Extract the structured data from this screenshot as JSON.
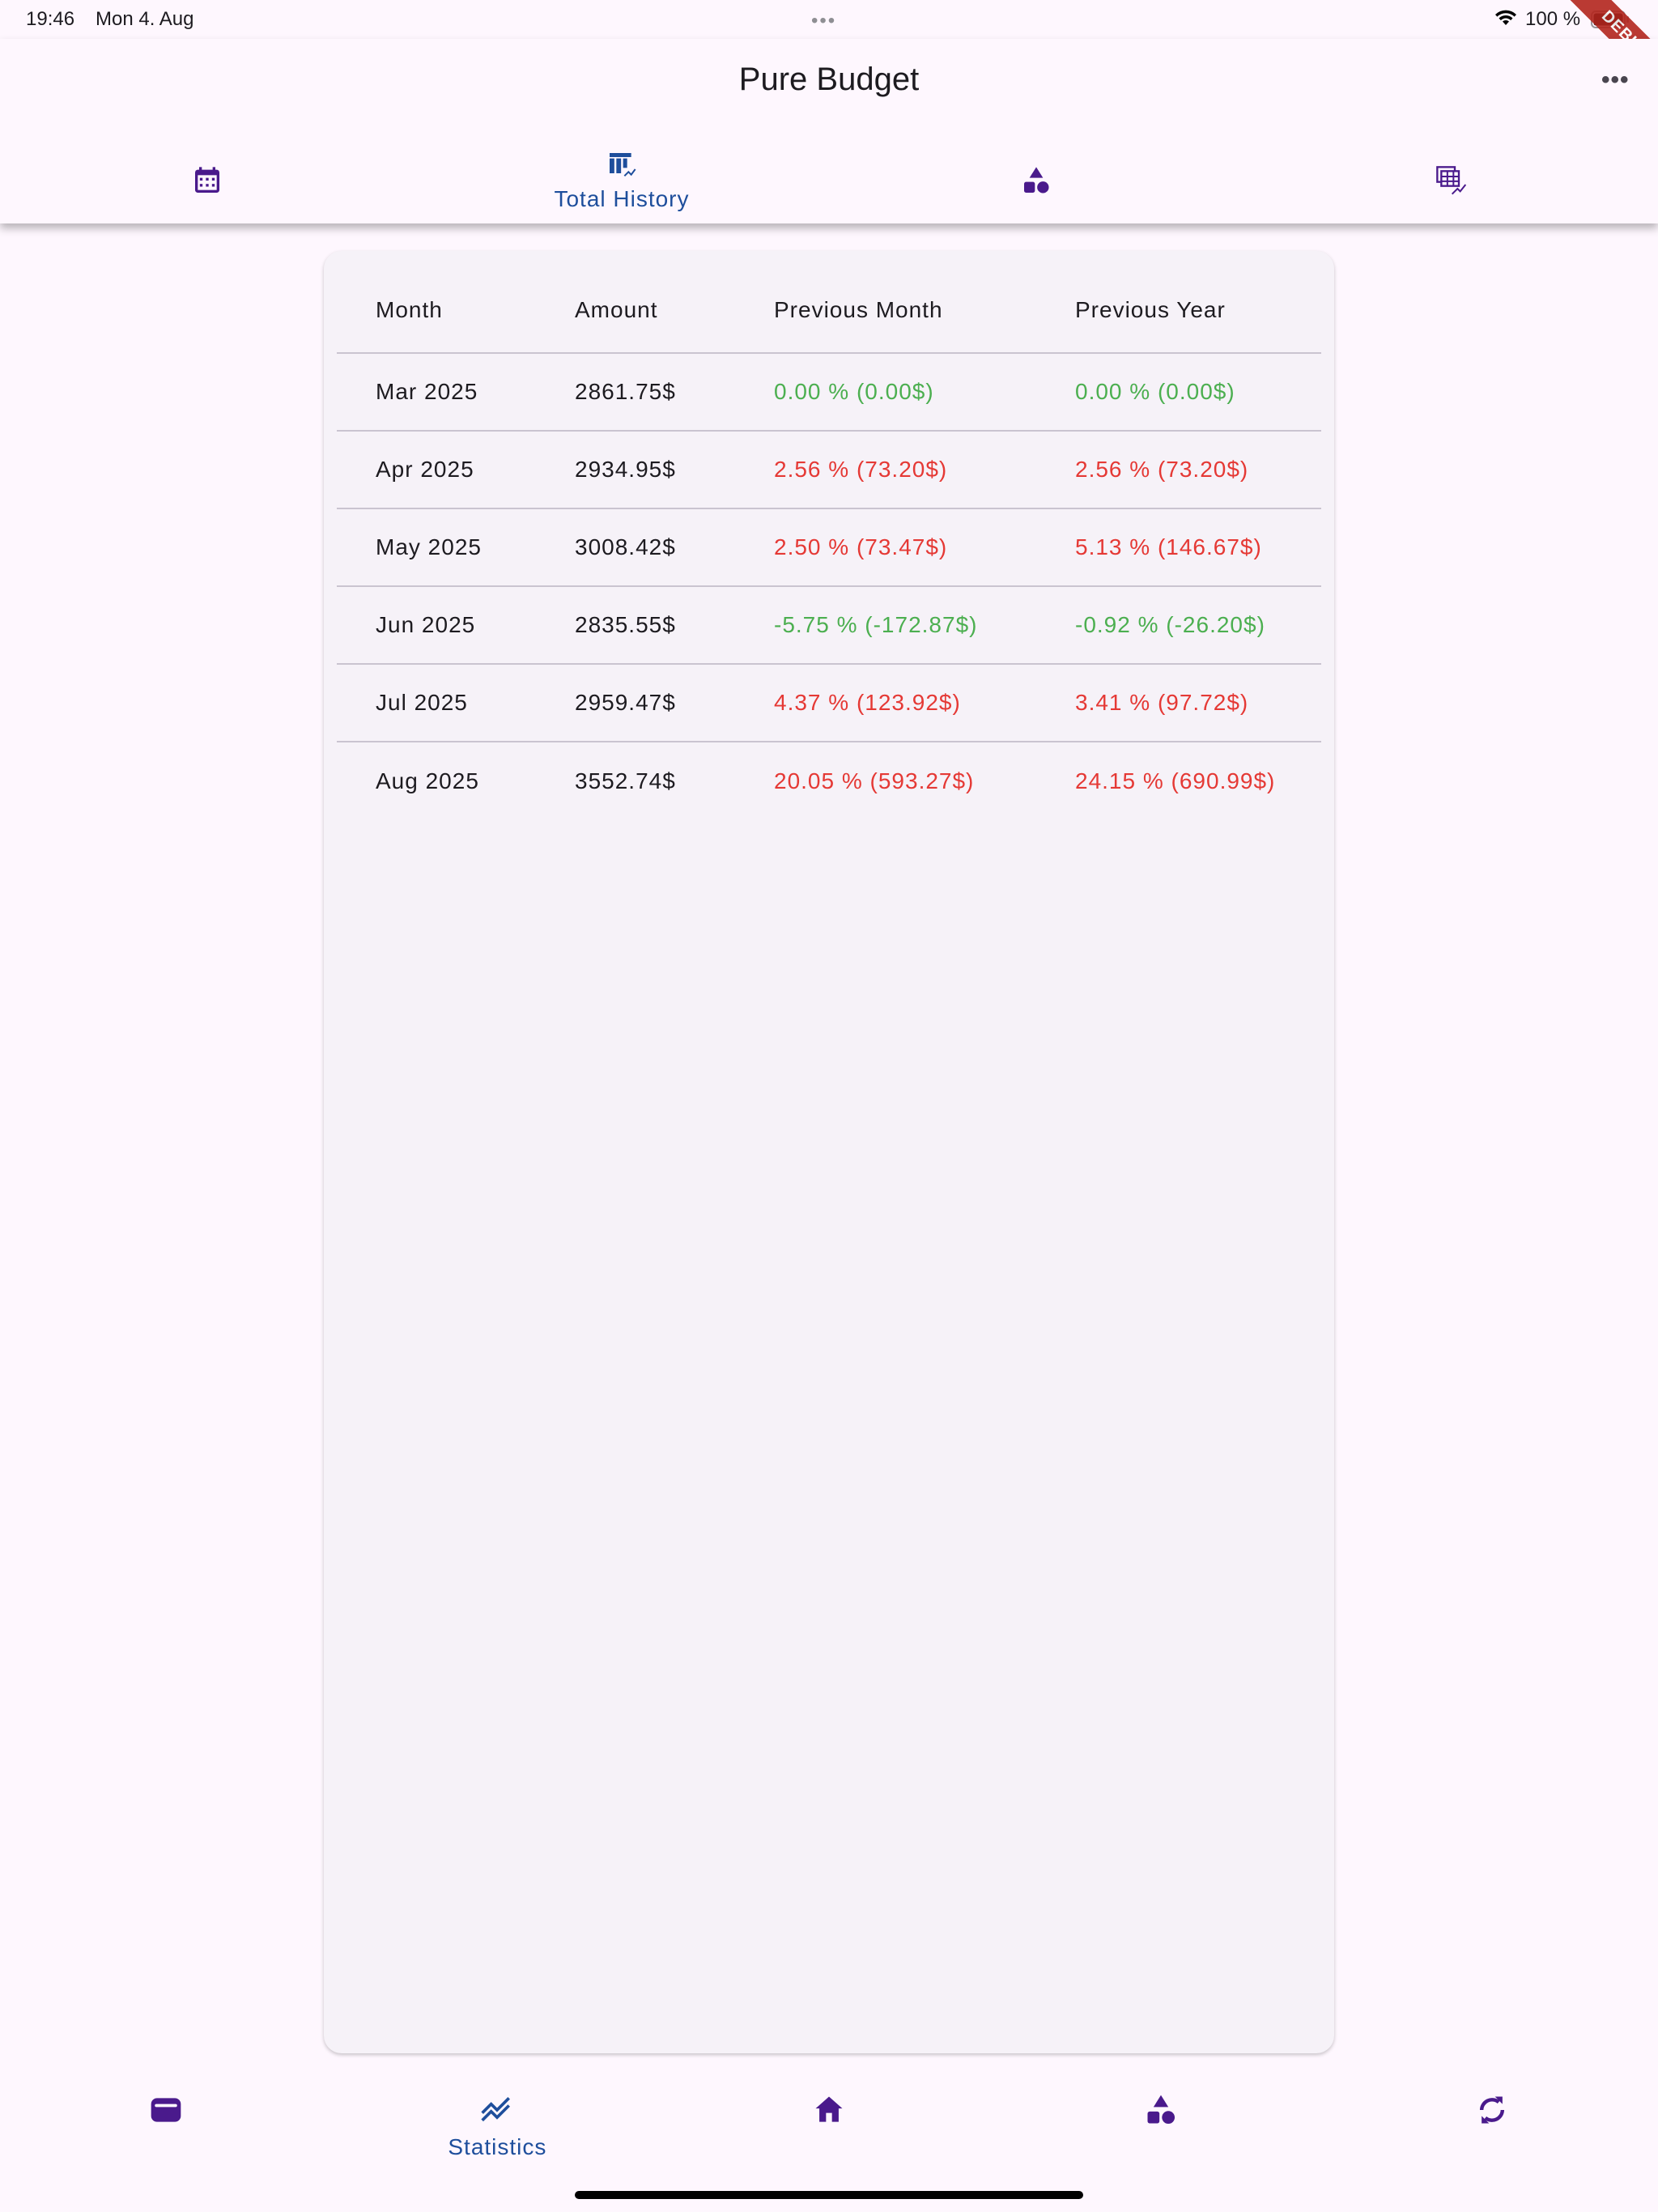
{
  "status_bar": {
    "time": "19:46",
    "date": "Mon 4. Aug",
    "battery": "100 %",
    "debug": "DEBUG"
  },
  "app_bar": {
    "title": "Pure Budget",
    "more_icon": "more-horizontal-icon",
    "tabs": [
      {
        "icon": "calendar-icon",
        "label": ""
      },
      {
        "icon": "table-history-icon",
        "label": "Total History",
        "active": true
      },
      {
        "icon": "category-shapes-icon",
        "label": ""
      },
      {
        "icon": "table-trend-icon",
        "label": ""
      }
    ]
  },
  "table": {
    "headers": [
      "Month",
      "Amount",
      "Previous Month",
      "Previous Year"
    ],
    "rows": [
      {
        "month": "Mar 2025",
        "amount": "2861.75$",
        "prev_month": "0.00 % (0.00$)",
        "prev_month_trend": "pos",
        "prev_year": "0.00 % (0.00$)",
        "prev_year_trend": "pos"
      },
      {
        "month": "Apr 2025",
        "amount": "2934.95$",
        "prev_month": "2.56 % (73.20$)",
        "prev_month_trend": "neg",
        "prev_year": "2.56 % (73.20$)",
        "prev_year_trend": "neg"
      },
      {
        "month": "May 2025",
        "amount": "3008.42$",
        "prev_month": "2.50 % (73.47$)",
        "prev_month_trend": "neg",
        "prev_year": "5.13 % (146.67$)",
        "prev_year_trend": "neg"
      },
      {
        "month": "Jun 2025",
        "amount": "2835.55$",
        "prev_month": "-5.75 % (-172.87$)",
        "prev_month_trend": "pos",
        "prev_year": "-0.92 % (-26.20$)",
        "prev_year_trend": "pos"
      },
      {
        "month": "Jul 2025",
        "amount": "2959.47$",
        "prev_month": "4.37 % (123.92$)",
        "prev_month_trend": "neg",
        "prev_year": "3.41 % (97.72$)",
        "prev_year_trend": "neg"
      },
      {
        "month": "Aug 2025",
        "amount": "3552.74$",
        "prev_month": "20.05 % (593.27$)",
        "prev_month_trend": "neg",
        "prev_year": "24.15 % (690.99$)",
        "prev_year_trend": "neg"
      }
    ]
  },
  "bottom_nav": [
    {
      "icon": "wallet-icon",
      "label": ""
    },
    {
      "icon": "statistics-icon",
      "label": "Statistics",
      "active": true
    },
    {
      "icon": "home-icon",
      "label": ""
    },
    {
      "icon": "category-shapes-icon",
      "label": ""
    },
    {
      "icon": "sync-icon",
      "label": ""
    }
  ],
  "colors": {
    "background": "#fef7fe",
    "card": "#f6f2f8",
    "accent": "#1e4e9c",
    "icon": "#4a1a8c",
    "positive": "#4caf50",
    "negative": "#e53935"
  }
}
